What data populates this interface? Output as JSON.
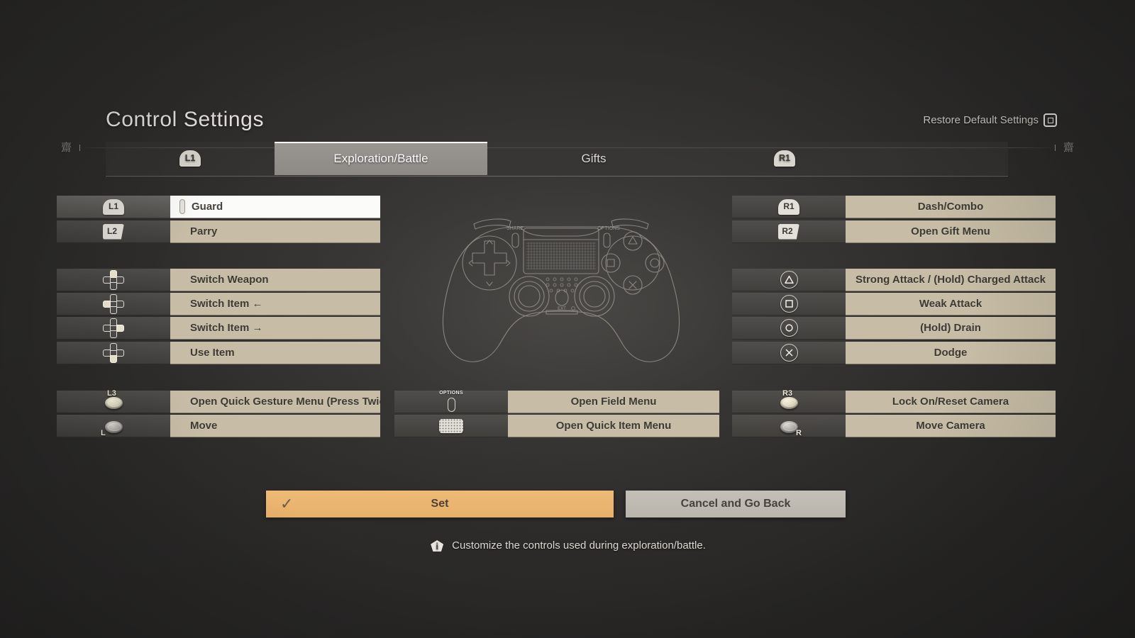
{
  "header": {
    "title": "Control Settings",
    "restore_label": "Restore Default Settings",
    "restore_button_icon": "square-button-icon",
    "ornament_left": "齋",
    "ornament_right": "齋"
  },
  "tabs": {
    "prev_bumper": "L1",
    "next_bumper": "R1",
    "items": [
      {
        "label": "Exploration/Battle",
        "active": true
      },
      {
        "label": "Gifts",
        "active": false
      }
    ]
  },
  "bindings": {
    "left_column": [
      {
        "group": 1,
        "icon": "shoulder-l1-icon",
        "key": "L1",
        "action": "Guard",
        "selected": true
      },
      {
        "group": 1,
        "icon": "trigger-l2-icon",
        "key": "L2",
        "action": "Parry",
        "selected": false
      },
      {
        "group": 2,
        "icon": "dpad-up-icon",
        "key": "Up",
        "action": "Switch Weapon",
        "selected": false
      },
      {
        "group": 2,
        "icon": "dpad-left-icon",
        "key": "Left",
        "action": "Switch Item ←",
        "selected": false
      },
      {
        "group": 2,
        "icon": "dpad-right-icon",
        "key": "Right",
        "action": "Switch Item →",
        "selected": false
      },
      {
        "group": 2,
        "icon": "dpad-down-icon",
        "key": "Down",
        "action": "Use Item",
        "selected": false
      },
      {
        "group": 3,
        "icon": "stick-l3-icon",
        "key": "L3",
        "action": "Open Quick Gesture Menu (Press Twice)",
        "selected": false
      },
      {
        "group": 3,
        "icon": "stick-l-icon",
        "key": "L",
        "action": "Move",
        "selected": false
      }
    ],
    "center_column": [
      {
        "icon": "options-button-icon",
        "key": "OPTIONS",
        "action": "Open Field Menu"
      },
      {
        "icon": "touchpad-icon",
        "key": "Touchpad",
        "action": "Open Quick Item Menu"
      }
    ],
    "right_column": [
      {
        "group": 1,
        "icon": "shoulder-r1-icon",
        "key": "R1",
        "action": "Dash/Combo"
      },
      {
        "group": 1,
        "icon": "trigger-r2-icon",
        "key": "R2",
        "action": "Open Gift Menu"
      },
      {
        "group": 2,
        "icon": "triangle-button-icon",
        "key": "Triangle",
        "action": "Strong Attack / (Hold) Charged Attack"
      },
      {
        "group": 2,
        "icon": "square-button-icon",
        "key": "Square",
        "action": "Weak Attack"
      },
      {
        "group": 2,
        "icon": "circle-button-icon",
        "key": "Circle",
        "action": "(Hold) Drain"
      },
      {
        "group": 2,
        "icon": "cross-button-icon",
        "key": "Cross",
        "action": "Dodge"
      },
      {
        "group": 3,
        "icon": "stick-r3-icon",
        "key": "R3",
        "action": "Lock On/Reset Camera"
      },
      {
        "group": 3,
        "icon": "stick-r-icon",
        "key": "R",
        "action": "Move Camera"
      }
    ]
  },
  "controller_art": {
    "name": "dualshock-controller-diagram",
    "share_label": "SHARE",
    "options_label": "OPTIONS",
    "ext_label": "EXT"
  },
  "footer": {
    "set_label": "Set",
    "set_icon": "check-icon",
    "cancel_label": "Cancel and Go Back",
    "hint_icon": "info-icon",
    "hint_text": "Customize the controls used during exploration/battle."
  },
  "colors": {
    "background": "#2b2a29",
    "row_value": "#c7bda6",
    "row_selected": "#fbfbfa",
    "accent_confirm": "#e7b06a",
    "cancel": "#bdb9b1",
    "tab_active": "#938f8a"
  }
}
